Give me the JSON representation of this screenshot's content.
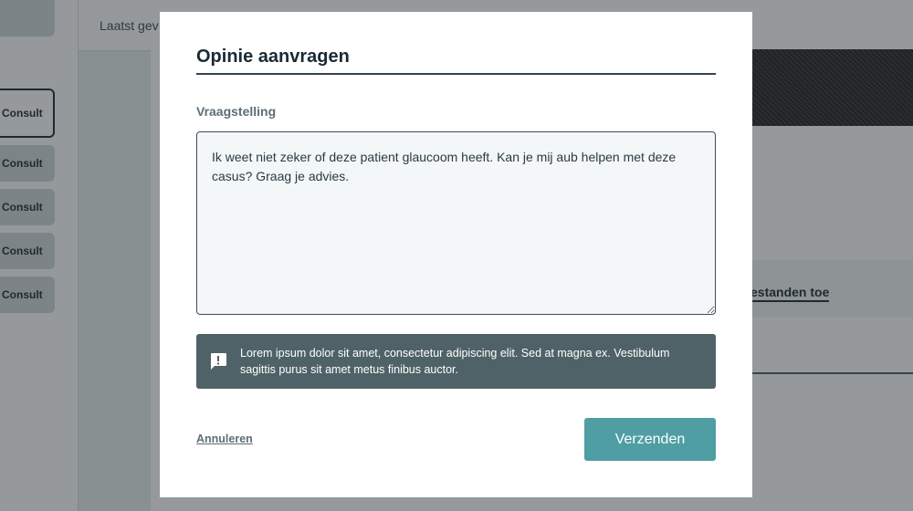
{
  "background": {
    "header_text": "Laatst gev",
    "consult_buttons": [
      "Consult",
      "Consult",
      "Consult",
      "Consult",
      "Consult"
    ],
    "link_text": "estanden toe"
  },
  "modal": {
    "title": "Opinie aanvragen",
    "field_label": "Vraagstelling",
    "question_value": "Ik weet niet zeker of deze patient glaucoom heeft. Kan je mij aub helpen met deze casus? Graag je advies. ",
    "alert": {
      "icon": "alert-message-icon",
      "text": "Lorem ipsum dolor sit amet, consectetur adipiscing elit. Sed at magna ex. Vestibulum sagittis purus sit amet metus finibus auctor."
    },
    "cancel_label": "Annuleren",
    "send_label": "Verzenden"
  },
  "colors": {
    "accent": "#4f9ea3",
    "alert_bg": "#4f6267",
    "title_color": "#1a2a33",
    "overlay": "rgba(33,41,45,0.48)"
  }
}
